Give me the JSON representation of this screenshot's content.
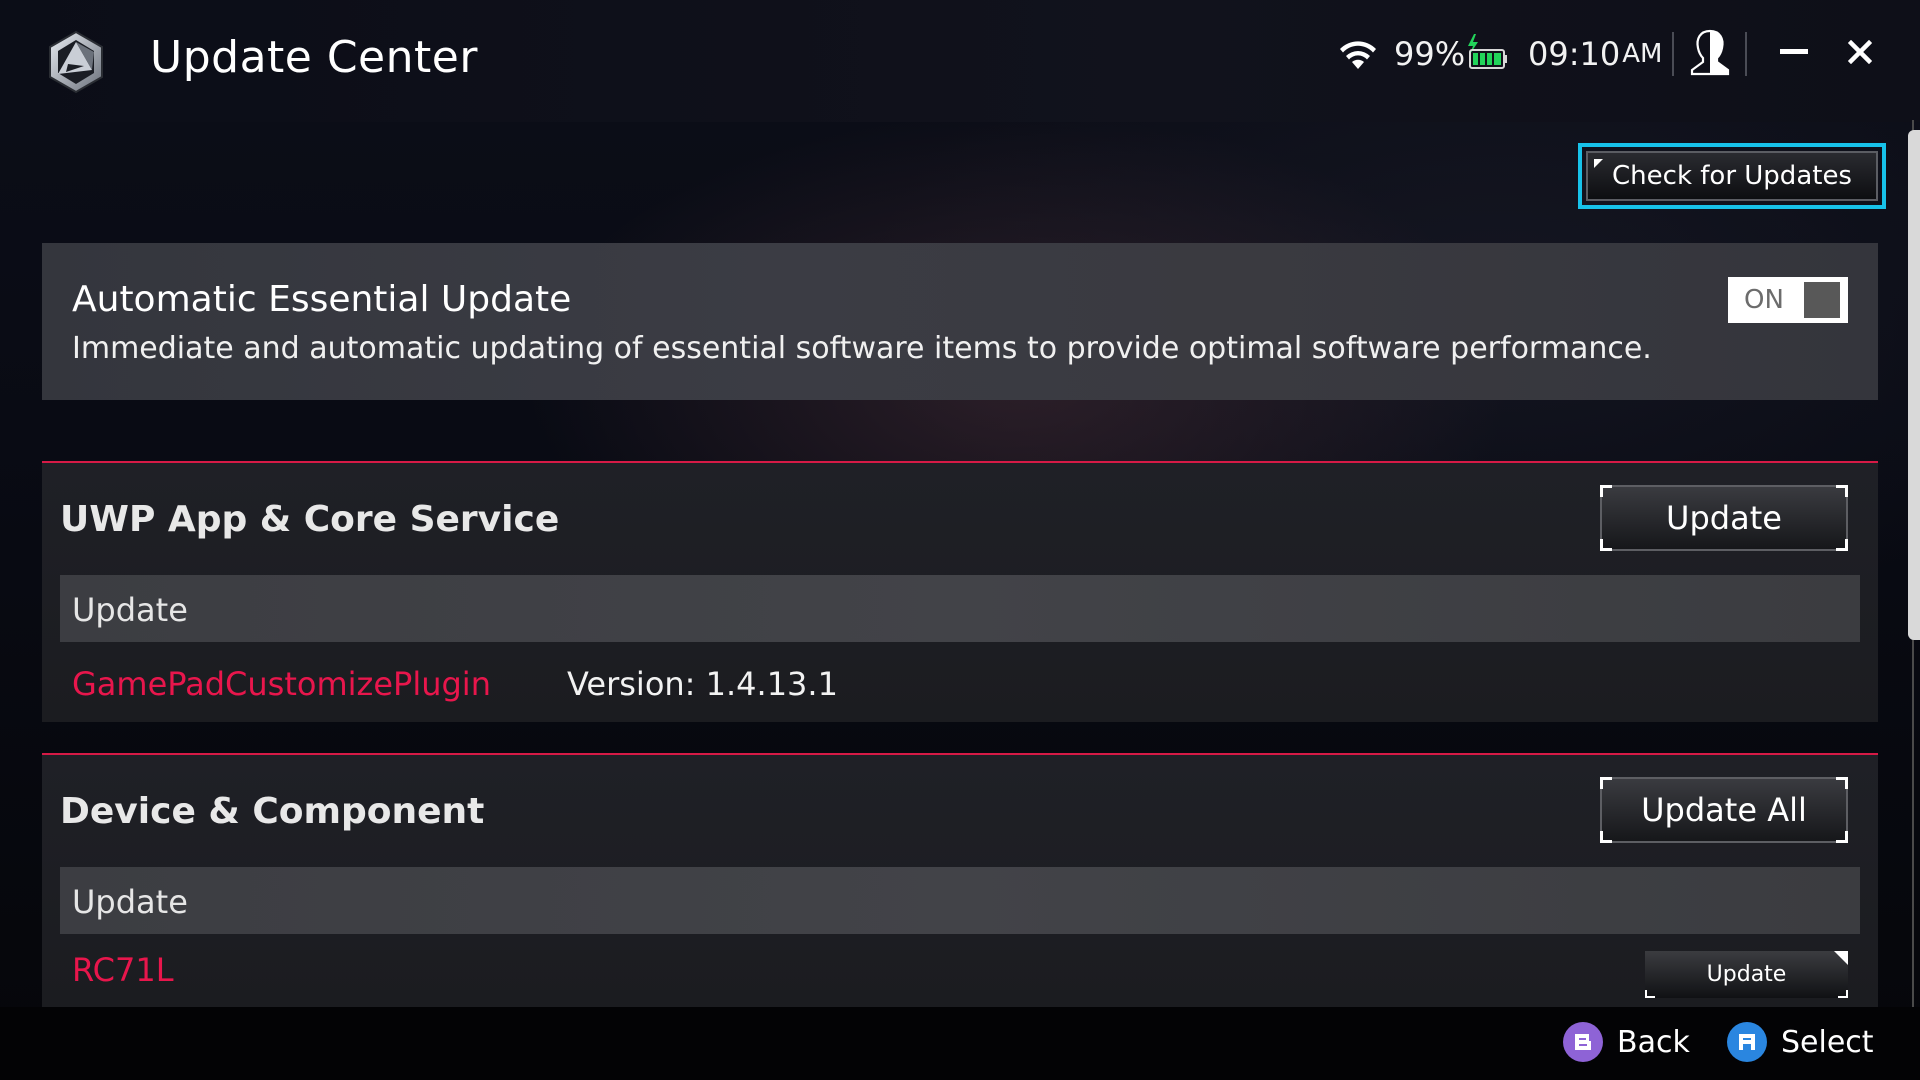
{
  "app": {
    "title": "Update Center",
    "logo_icon": "rog-armoury-hexagon-logo"
  },
  "status_bar": {
    "wifi_icon": "wifi-icon",
    "battery_percent": "99%",
    "battery_icon": "battery-charging-icon",
    "battery_color": "#22d45a",
    "time": "09:10",
    "time_suffix": "AM",
    "user_icon": "user-profile-icon"
  },
  "window_controls": {
    "minimize": "minimize-icon",
    "close": "close-icon"
  },
  "toolbar": {
    "check_updates_label": "Check for Updates",
    "focus_color": "#17c2ea"
  },
  "auto_update": {
    "title": "Automatic Essential Update",
    "description": "Immediate and automatic updating of essential software items to provide optimal software performance.",
    "toggle_label": "ON",
    "enabled": true
  },
  "sections": [
    {
      "title": "UWP App & Core Service",
      "action_label": "Update",
      "list_header": "Update",
      "items": [
        {
          "name": "GamePadCustomizePlugin",
          "version": "Version: 1.4.13.1"
        }
      ]
    },
    {
      "title": "Device & Component",
      "action_label": "Update All",
      "list_header": "Update",
      "items": [
        {
          "name": "RC71L",
          "action_label": "Update"
        }
      ]
    }
  ],
  "accent_color": "#e8164c",
  "footer": {
    "hints": [
      {
        "button": "B",
        "label": "Back",
        "color": "#8e63d6"
      },
      {
        "button": "A",
        "label": "Select",
        "color": "#2a86e0"
      }
    ]
  }
}
